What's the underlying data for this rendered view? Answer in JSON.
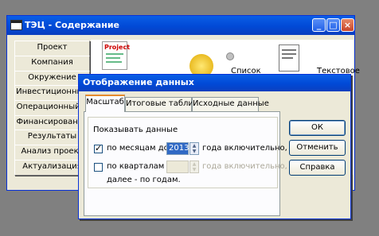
{
  "main_window": {
    "title": "ТЭЦ - Содержание",
    "nav_items": [
      "Проект",
      "Компания",
      "Окружение",
      "Инвестиционный",
      "Операционный п",
      "Финансирование",
      "Результаты",
      "Анализ проект",
      "Актуализация"
    ],
    "content_labels": {
      "project_label": "Project",
      "list_label": "Список",
      "text_label": "Текстовое"
    }
  },
  "dialog": {
    "title": "Отображение данных",
    "tabs": [
      "Масштаб",
      "Итоговые таблицы",
      "Исходные данные"
    ],
    "active_tab": "Масштаб",
    "group_label": "Показывать данные",
    "monthly": {
      "checked": true,
      "label": "по месяцам до",
      "value": "2013",
      "suffix": "года включительно,"
    },
    "quarterly": {
      "checked": false,
      "label": "по кварталам до",
      "value": "",
      "suffix": "года включительно,"
    },
    "yearly_text": "далее - по годам.",
    "buttons": {
      "ok": "ОК",
      "cancel": "Отменить",
      "help": "Справка"
    }
  },
  "colors": {
    "titlebar": "#0149d6",
    "desktop": "#808080",
    "dialog_bg": "#ece9d8",
    "tab_accent": "#e68b2c"
  }
}
